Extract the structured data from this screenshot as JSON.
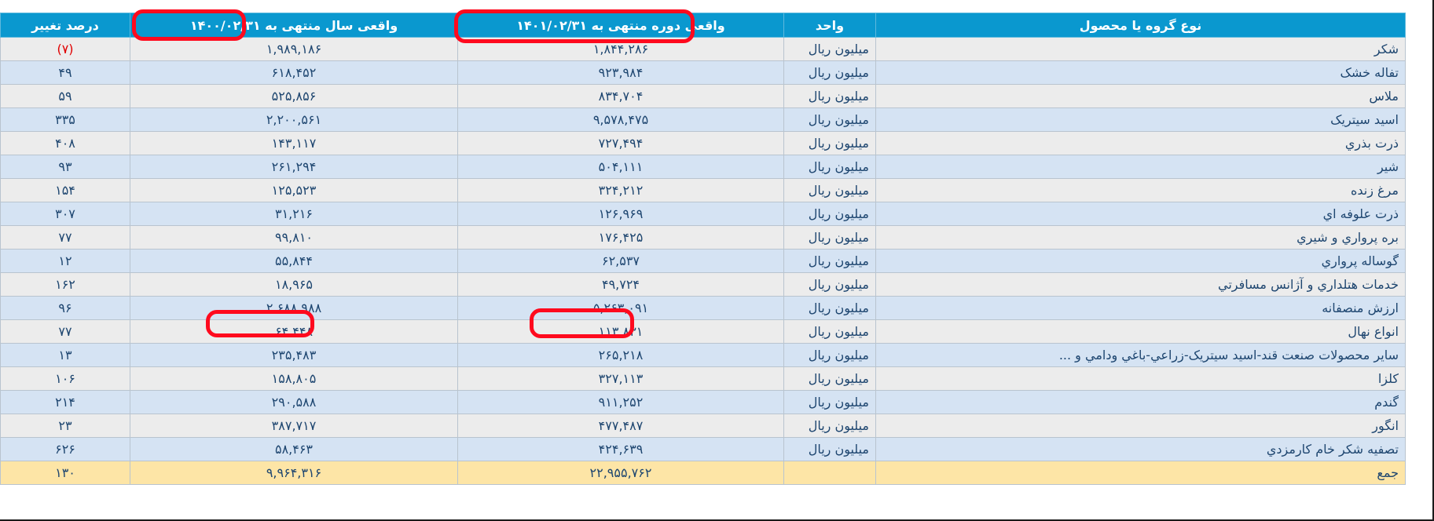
{
  "table": {
    "headers": {
      "product": "نوع گروه یا محصول",
      "unit": "واحد",
      "period": "واقعی دوره منتهی به ۱۴۰۱/۰۲/۳۱",
      "year": "واقعی سال منتهی به ۱۴۰۰/۰۲/۳۱",
      "change": "درصد تغییر"
    },
    "rows": [
      {
        "product": "شکر",
        "unit": "میلیون ریال",
        "period": "۱,۸۴۴,۲۸۶",
        "year": "۱,۹۸۹,۱۸۶",
        "change": "(۷)"
      },
      {
        "product": "تفاله خشک",
        "unit": "میلیون ریال",
        "period": "۹۲۳,۹۸۴",
        "year": "۶۱۸,۴۵۲",
        "change": "۴۹"
      },
      {
        "product": "ملاس",
        "unit": "میلیون ریال",
        "period": "۸۳۴,۷۰۴",
        "year": "۵۲۵,۸۵۶",
        "change": "۵۹"
      },
      {
        "product": "اسید سیتریک",
        "unit": "میلیون ریال",
        "period": "۹,۵۷۸,۴۷۵",
        "year": "۲,۲۰۰,۵۶۱",
        "change": "۳۳۵"
      },
      {
        "product": "ذرت بذري",
        "unit": "میلیون ریال",
        "period": "۷۲۷,۴۹۴",
        "year": "۱۴۳,۱۱۷",
        "change": "۴۰۸"
      },
      {
        "product": "شیر",
        "unit": "میلیون ریال",
        "period": "۵۰۴,۱۱۱",
        "year": "۲۶۱,۲۹۴",
        "change": "۹۳"
      },
      {
        "product": "مرغ زنده",
        "unit": "میلیون ریال",
        "period": "۳۲۴,۲۱۲",
        "year": "۱۲۵,۵۲۳",
        "change": "۱۵۴"
      },
      {
        "product": "ذرت علوفه اي",
        "unit": "میلیون ریال",
        "period": "۱۲۶,۹۶۹",
        "year": "۳۱,۲۱۶",
        "change": "۳۰۷"
      },
      {
        "product": "بره پرواري و شيري",
        "unit": "میلیون ریال",
        "period": "۱۷۶,۴۲۵",
        "year": "۹۹,۸۱۰",
        "change": "۷۷"
      },
      {
        "product": "گوساله پرواري",
        "unit": "میلیون ریال",
        "period": "۶۲,۵۳۷",
        "year": "۵۵,۸۴۴",
        "change": "۱۲"
      },
      {
        "product": "خدمات هتلداري و آژانس مسافرتي",
        "unit": "میلیون ریال",
        "period": "۴۹,۷۲۴",
        "year": "۱۸,۹۶۵",
        "change": "۱۶۲"
      },
      {
        "product": "ارزش منصفانه",
        "unit": "میلیون ریال",
        "period": "۵,۲۶۳,۰۹۱",
        "year": "۲,۶۸۸,۹۸۸",
        "change": "۹۶"
      },
      {
        "product": "انواع نهال",
        "unit": "میلیون ریال",
        "period": "۱۱۳,۸۳۱",
        "year": "۶۴,۴۴۸",
        "change": "۷۷"
      },
      {
        "product": "سایر محصولات صنعت قند-اسید سیتریک-زراعي-باغي ودامي و ...",
        "unit": "میلیون ریال",
        "period": "۲۶۵,۲۱۸",
        "year": "۲۳۵,۴۸۳",
        "change": "۱۳"
      },
      {
        "product": "کلزا",
        "unit": "میلیون ریال",
        "period": "۳۲۷,۱۱۳",
        "year": "۱۵۸,۸۰۵",
        "change": "۱۰۶"
      },
      {
        "product": "گندم",
        "unit": "میلیون ریال",
        "period": "۹۱۱,۲۵۲",
        "year": "۲۹۰,۵۸۸",
        "change": "۲۱۴"
      },
      {
        "product": "انگور",
        "unit": "میلیون ریال",
        "period": "۴۷۷,۴۸۷",
        "year": "۳۸۷,۷۱۷",
        "change": "۲۳"
      },
      {
        "product": "تصفیه شکر خام کارمزدي",
        "unit": "میلیون ریال",
        "period": "۴۲۴,۶۳۹",
        "year": "۵۸,۴۶۳",
        "change": "۶۲۶"
      }
    ],
    "total": {
      "label": "جمع",
      "unit": "",
      "period": "۲۲,۹۵۵,۷۶۲",
      "year": "۹,۹۶۴,۳۱۶",
      "change": "۱۳۰"
    }
  },
  "colors": {
    "header": "#0a98cf",
    "row_odd": "#ececec",
    "row_even": "#d5e3f3",
    "total_row": "#fde5a6",
    "text": "#1e4670",
    "negative": "#e00000",
    "highlight": "#ff0a1e"
  }
}
